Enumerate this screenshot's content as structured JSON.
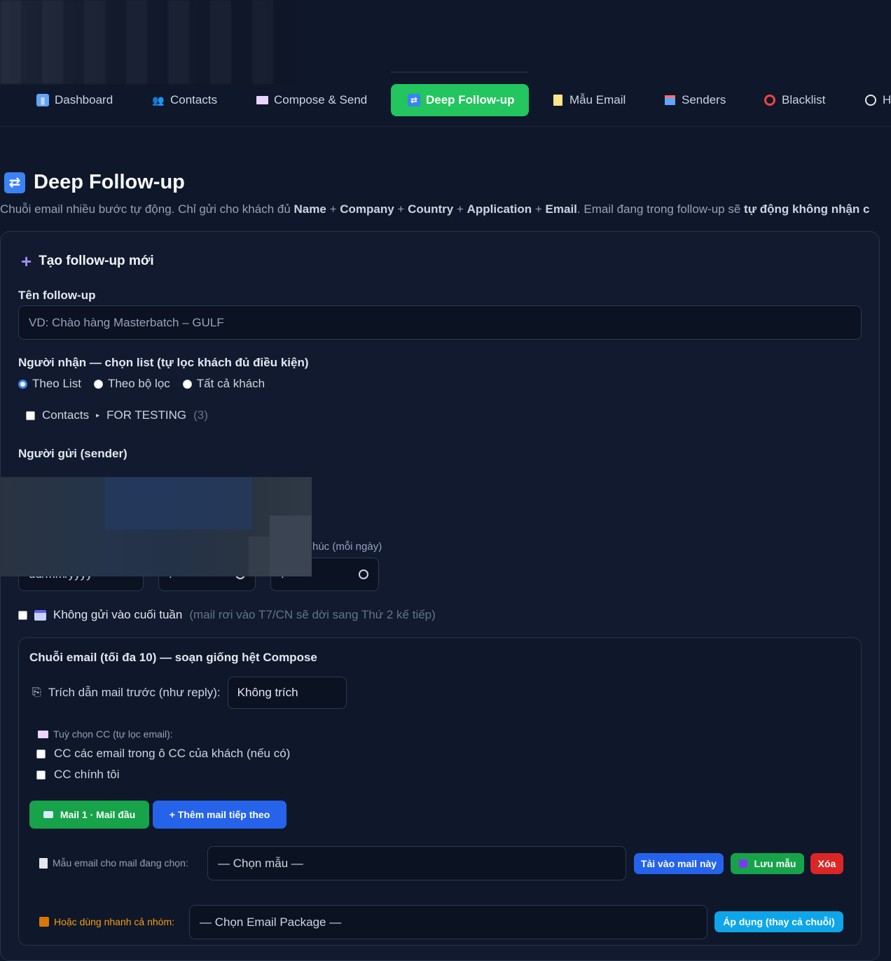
{
  "nav": {
    "items": [
      {
        "label": "Dashboard",
        "icon": "bar-chart-icon"
      },
      {
        "label": "Contacts",
        "icon": "users-icon"
      },
      {
        "label": "Compose & Send",
        "icon": "envelope-icon"
      },
      {
        "label": "Deep Follow-up",
        "icon": "repeat-icon"
      },
      {
        "label": "Mẫu Email",
        "icon": "memo-icon"
      },
      {
        "label": "Senders",
        "icon": "outbox-icon"
      },
      {
        "label": "Blacklist",
        "icon": "prohibited-icon"
      },
      {
        "label": "H",
        "icon": "clock-icon"
      }
    ]
  },
  "page": {
    "title": "Deep Follow-up",
    "subtitle_parts": [
      {
        "t": "Chuỗi email nhiều bước tự động. Chỉ gửi cho khách đủ ",
        "b": false
      },
      {
        "t": "Name",
        "b": true
      },
      {
        "t": " + ",
        "b": false
      },
      {
        "t": "Company",
        "b": true
      },
      {
        "t": " + ",
        "b": false
      },
      {
        "t": "Country",
        "b": true
      },
      {
        "t": " + ",
        "b": false
      },
      {
        "t": "Application",
        "b": true
      },
      {
        "t": " + ",
        "b": false
      },
      {
        "t": "Email",
        "b": true
      },
      {
        "t": ". Email đang trong follow-up sẽ ",
        "b": false
      },
      {
        "t": "tự động không nhận c",
        "b": true
      }
    ]
  },
  "form": {
    "card_title": "Tạo follow-up mới",
    "name_label": "Tên follow-up",
    "name_placeholder": "VD: Chào hàng Masterbatch – GULF",
    "recipients_label": "Người nhận — chọn list (tự lọc khách đủ điều kiện)",
    "recipient_modes": [
      "Theo List",
      "Theo bộ lọc",
      "Tất cả khách"
    ],
    "list_item": {
      "group": "Contacts",
      "name": "FOR TESTING",
      "count": "(3)"
    },
    "sender_label": "Người gửi (sender)",
    "end_label_partial": "húc (mỗi ngày)",
    "date_placeholder": "dd/mm/yyyy",
    "time_placeholder_1": ":",
    "time_placeholder_2": ":--",
    "weekend_label": "Không gửi vào cuối tuần",
    "weekend_hint": "(mail rơi vào T7/CN sẽ dời sang Thứ 2 kế tiếp)"
  },
  "sequence": {
    "title": "Chuỗi email (tối đa 10) — soạn giống hệt Compose",
    "quote_label": "Trích dẫn mail trước (như reply):",
    "quote_value": "Không trích",
    "cc_head": "Tuỳ chọn CC (tự lọc email):",
    "cc_options": [
      "CC các email trong ô CC của khách (nếu có)",
      "CC chính tôi"
    ],
    "mail_tab": "Mail 1 · Mail đầu",
    "add_mail": "+ Thêm mail tiếp theo",
    "template_label": "Mẫu email cho mail đang chọn:",
    "template_value": "— Chọn mẫu —",
    "load_button": "Tải vào mail này",
    "save_button": "Lưu mẫu",
    "delete_button": "Xóa",
    "package_label": "Hoặc dùng nhanh cả nhóm:",
    "package_value": "— Chọn Email Package —",
    "apply_button": "Áp dụng (thay cả chuỗi)"
  },
  "colors": {
    "accent_green": "#22c55e",
    "accent_blue": "#2563eb",
    "danger": "#dc2626",
    "sky": "#0ea5e9",
    "background": "#0f172a"
  }
}
